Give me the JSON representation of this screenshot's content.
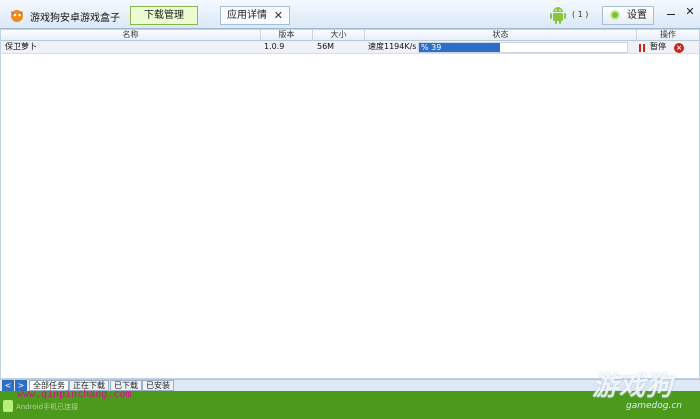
{
  "app": {
    "title": "游戏狗安卓游戏盒子",
    "tabs": {
      "download": "下载管理",
      "detail": "应用详情",
      "detail_close": "✕"
    },
    "android_count": "( 1 )",
    "settings_label": "设置",
    "close_glyph": "✕"
  },
  "table": {
    "headers": {
      "name": "名称",
      "version": "版本",
      "size": "大小",
      "status": "状态",
      "action": "操作"
    },
    "rows": [
      {
        "name": "保卫萝卜",
        "version": "1.0.9",
        "size": "56M",
        "speed": "速度1194K/s",
        "progress_text": "% 39",
        "progress": 0.39,
        "action": "暂停"
      }
    ]
  },
  "bottom_tabs": {
    "prev": "<",
    "next": ">",
    "all": "全部任务",
    "downloading": "正在下载",
    "downloaded": "已下载",
    "installed": "已安装"
  },
  "status": {
    "text": "Android手机已连接"
  },
  "watermark": {
    "url": "www.qinpinchang.com",
    "brand": "游戏狗",
    "site": "gamedog.cn"
  },
  "colors": {
    "status_bar": "#4c9a1b",
    "progress": "#2e6ec7",
    "accent_tab": "#ecfbd1"
  }
}
